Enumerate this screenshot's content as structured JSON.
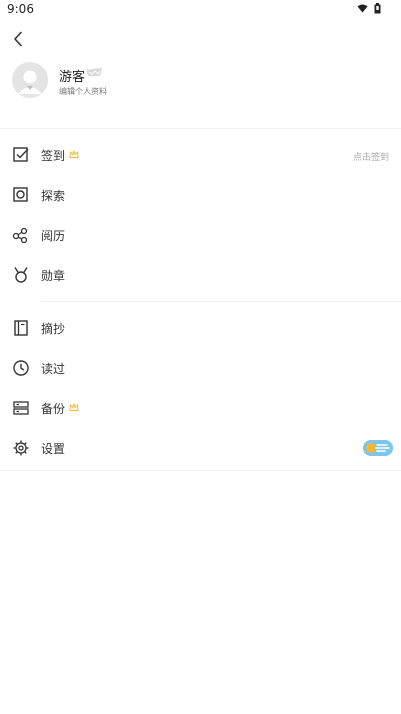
{
  "status_bar": {
    "time": "9:06"
  },
  "profile": {
    "name": "游客",
    "subtitle": "编辑个人资料"
  },
  "menu": {
    "checkin": {
      "label": "签到",
      "hint": "点击签到",
      "icon": "checkbox-icon"
    },
    "explore": {
      "label": "探索",
      "icon": "square-target-icon"
    },
    "history": {
      "label": "阅历",
      "icon": "nodes-icon"
    },
    "medals": {
      "label": "勋章",
      "icon": "medal-icon"
    },
    "excerpts": {
      "label": "摘抄",
      "icon": "notebook-icon"
    },
    "read": {
      "label": "读过",
      "icon": "clock-icon"
    },
    "backup": {
      "label": "备份",
      "icon": "server-icon"
    },
    "settings": {
      "label": "设置",
      "icon": "gear-icon"
    }
  },
  "colors": {
    "accent_gold": "#f3b83a",
    "toggle_blue": "#7ec6ea",
    "divider": "#f0f0f0"
  }
}
